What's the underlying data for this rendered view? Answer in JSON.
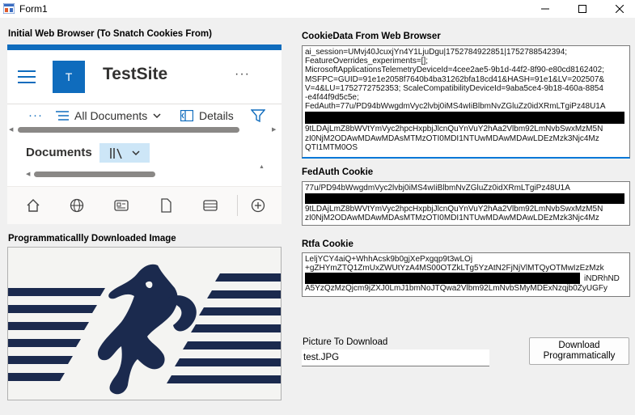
{
  "window": {
    "title": "Form1"
  },
  "browser_section": {
    "label": "Initial Web Browser (To Snatch Cookies From)",
    "site_logo_letter": "T",
    "site_name": "TestSite",
    "more_label": "···",
    "command_bar": {
      "more_label": "···",
      "all_documents": "All Documents",
      "details": "Details"
    },
    "documents_title": "Documents"
  },
  "image_section": {
    "label": "Programmaticallly Downloaded Image"
  },
  "cookie_data": {
    "label": "CookieData From Web Browser",
    "lines": [
      "ai_session=UMvj40JcuxjYn4Y1LjuDgu|1752784922851|1752788542394;",
      "FeatureOverrides_experiments=[];",
      "MicrosoftApplicationsTelemetryDeviceId=4cee2ae5-9b1d-44f2-8f90-e80cd8162402;",
      "MSFPC=GUID=91e1e2058f7640b4ba31262bfa18cd41&HASH=91e1&LV=202507&",
      "V=4&LU=1752772752353; ScaleCompatibilityDeviceId=9aba5ce4-9b18-460a-8854",
      "-e4f44f9d5c5e;",
      "FedAuth=77u/PD94bWwgdmVyc2lvbj0iMS4wIiBlbmNvZGluZz0idXRmLTgiPz48U1A"
    ],
    "lines_after": [
      "9tLDAjLmZ8bWVtYmVyc2hpcHxpbjJlcnQuYnVuY2hAa2Vlbm92LmNvbSwxMzM5N",
      "zI0NjM2ODAwMDAwMDAsMTMzOTI0MDI1NTUwMDAwMDAwLDEzMzk3Njc4Mz",
      "QTI1MTM0OS"
    ]
  },
  "fedauth": {
    "label": "FedAuth Cookie",
    "lines": [
      "77u/PD94bWwgdmVyc2lvbj0iMS4wIiBlbmNvZGluZz0idXRmLTgiPz48U1A"
    ],
    "lines_after": [
      "9tLDAjLmZ8bWVtYmVyc2hpcHxpbjJlcnQuYnVuY2hAa2Vlbm92LmNvbSwxMzM5N",
      "zI0NjM2ODAwMDAwMDAsMTMzOTI0MDI1NTUwMDAwMDAwLDEzMzk3Njc4Mz"
    ]
  },
  "rtfa": {
    "label": "Rtfa Cookie",
    "lines": [
      "LeljYCY4aiQ+WhhAcsk9b0gjXePxgqp9t3wLOj",
      "+gZHYmZTQ1ZmUxZWUtYzA4MS00OTZkLTg5YzAtN2FjNjVlMTQyOTMwIzEzMzk"
    ],
    "partial_tail": "iNDRhND",
    "lines_after": [
      "A5YzQzMzQjcm9jZXJ0LmJ1bmNoJTQwa2Vlbm92LmNvbSMyMDExNzqjb0ZyUGFy"
    ]
  },
  "download": {
    "label": "Picture To Download",
    "value": "test.JPG",
    "button_label_line1": "Download",
    "button_label_line2": "Programmatically"
  },
  "colors": {
    "sharepoint_blue": "#0f6cbd",
    "accent_focus": "#0078d7",
    "image_navy": "#1b2a4e"
  }
}
